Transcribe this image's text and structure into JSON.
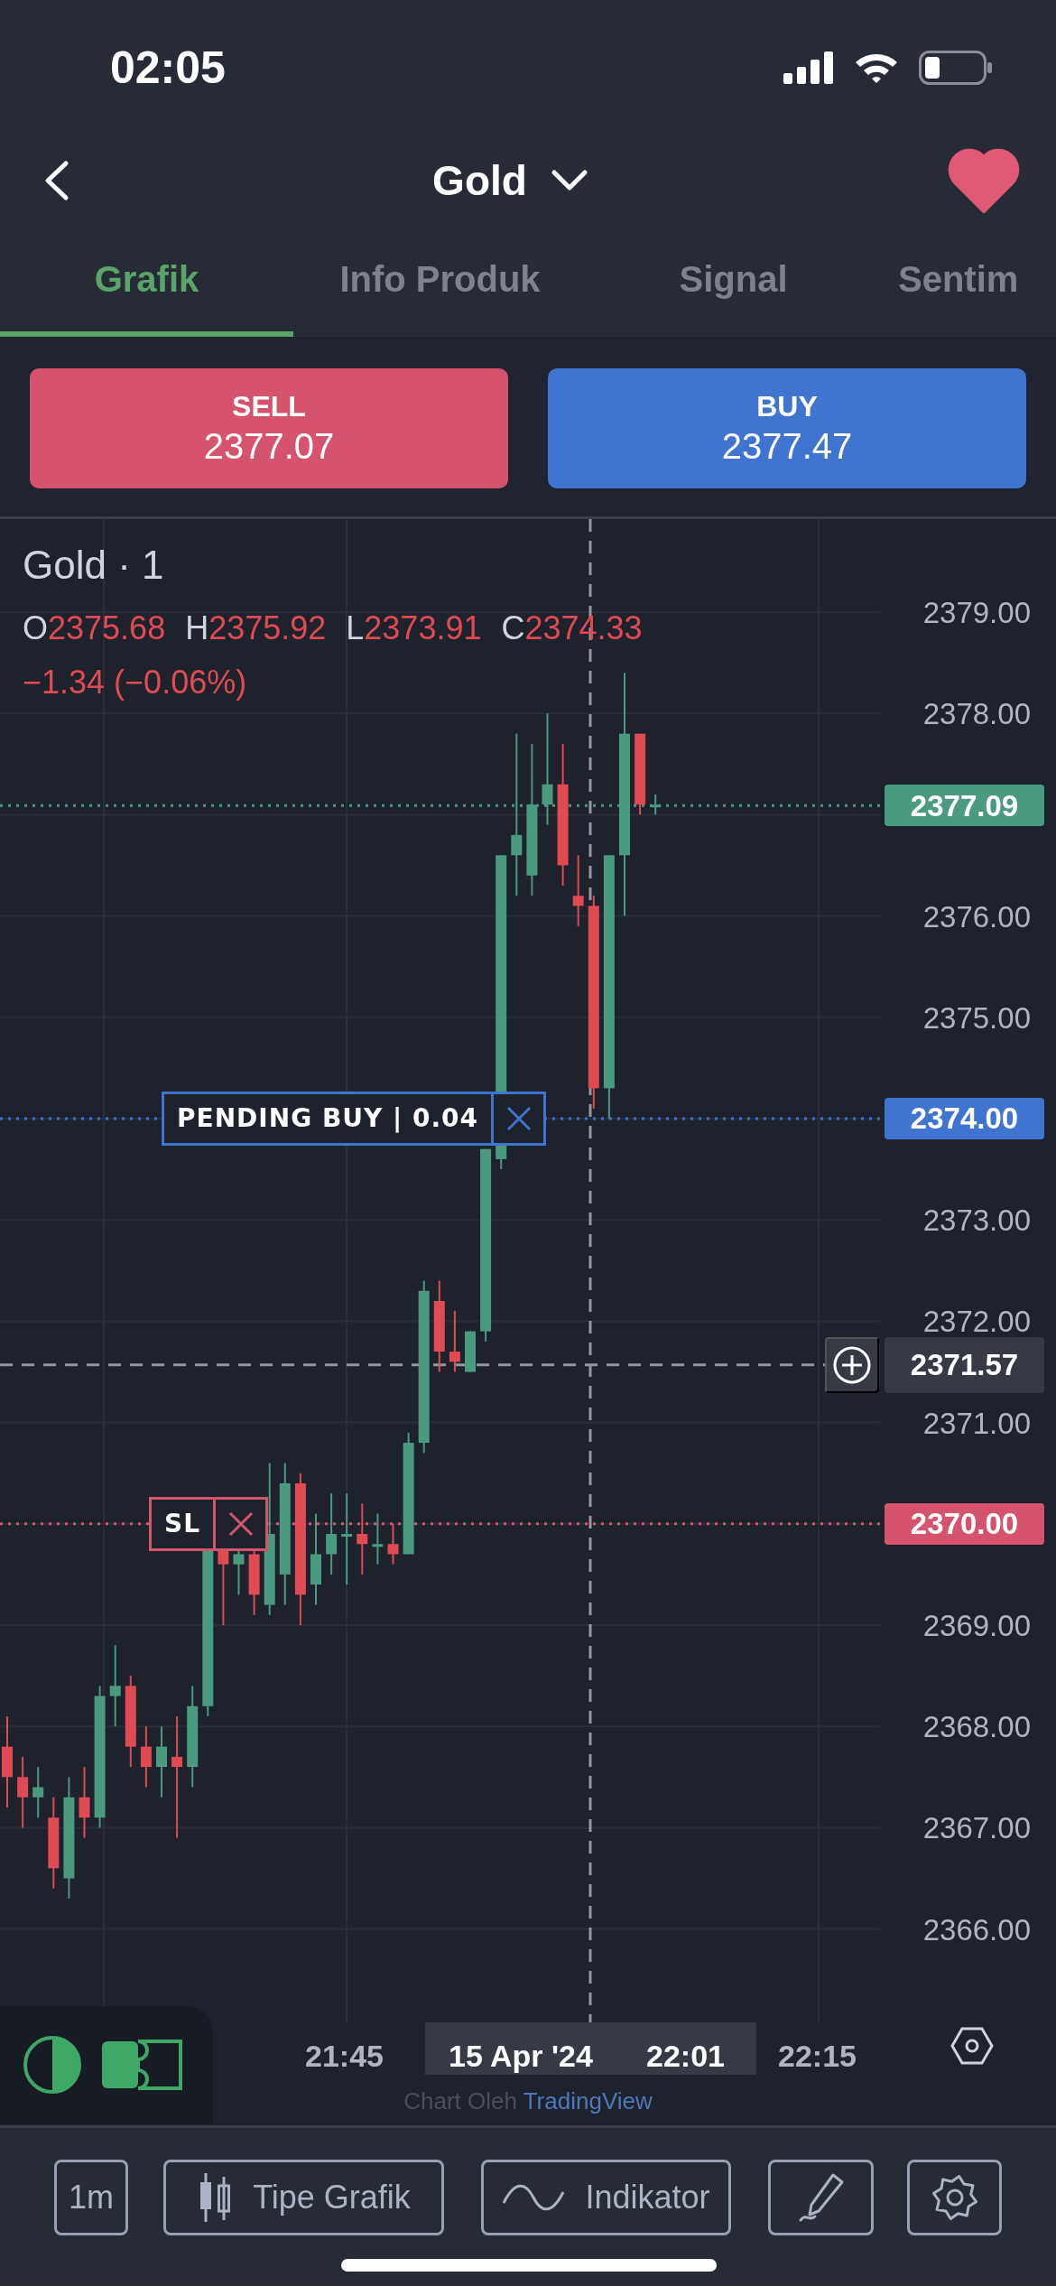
{
  "status_bar": {
    "time": "02:05"
  },
  "header": {
    "title": "Gold",
    "favorite": true
  },
  "tabs": [
    {
      "label": "Grafik",
      "selected": true
    },
    {
      "label": "Info Produk",
      "selected": false
    },
    {
      "label": "Signal",
      "selected": false
    },
    {
      "label": "Sentim",
      "selected": false
    }
  ],
  "trade_buttons": [
    {
      "kind": "sell",
      "label": "SELL",
      "price": "2377.07"
    },
    {
      "kind": "buy",
      "label": "BUY",
      "price": "2377.47"
    }
  ],
  "chart": {
    "title": "Gold · 1",
    "ohlc": [
      {
        "label": "O",
        "value": "2375.68"
      },
      {
        "label": "H",
        "value": "2375.92"
      },
      {
        "label": "L",
        "value": "2373.91"
      },
      {
        "label": "C",
        "value": "2374.33"
      }
    ],
    "change": "−1.34 (−0.06%)",
    "price_axis": [
      "2379.00",
      "2378.00",
      "2376.00",
      "2375.00",
      "2373.00",
      "2372.00",
      "2371.00",
      "2369.00",
      "2368.00",
      "2367.00",
      "2366.00"
    ],
    "price_tags": [
      {
        "kind": "last",
        "text": "2377.09",
        "color": "#4a9a80"
      },
      {
        "kind": "order",
        "text": "2374.00",
        "color": "#3f74d1",
        "order": {
          "kind": "pending",
          "label": "PENDING BUY | 0.04"
        }
      },
      {
        "kind": "crosshair",
        "text": "2371.57",
        "color": "#363a45"
      },
      {
        "kind": "order",
        "text": "2370.00",
        "color": "#d6536d",
        "order": {
          "kind": "sl",
          "label": "SL"
        }
      }
    ],
    "time_axis": [
      {
        "text": "21:45",
        "selected": false
      },
      {
        "text": "15 Apr '24",
        "selected": true
      },
      {
        "text": "22:01",
        "selected": true
      },
      {
        "text": "22:15",
        "selected": false
      }
    ],
    "attribution": {
      "prefix": "Chart Oleh",
      "link": "TradingView"
    }
  },
  "toolbar": [
    {
      "kind": "interval",
      "label": "1m"
    },
    {
      "kind": "chart-type",
      "label": "Tipe Grafik"
    },
    {
      "kind": "indicator",
      "label": "Indikator"
    },
    {
      "kind": "draw"
    },
    {
      "kind": "settings"
    }
  ]
}
